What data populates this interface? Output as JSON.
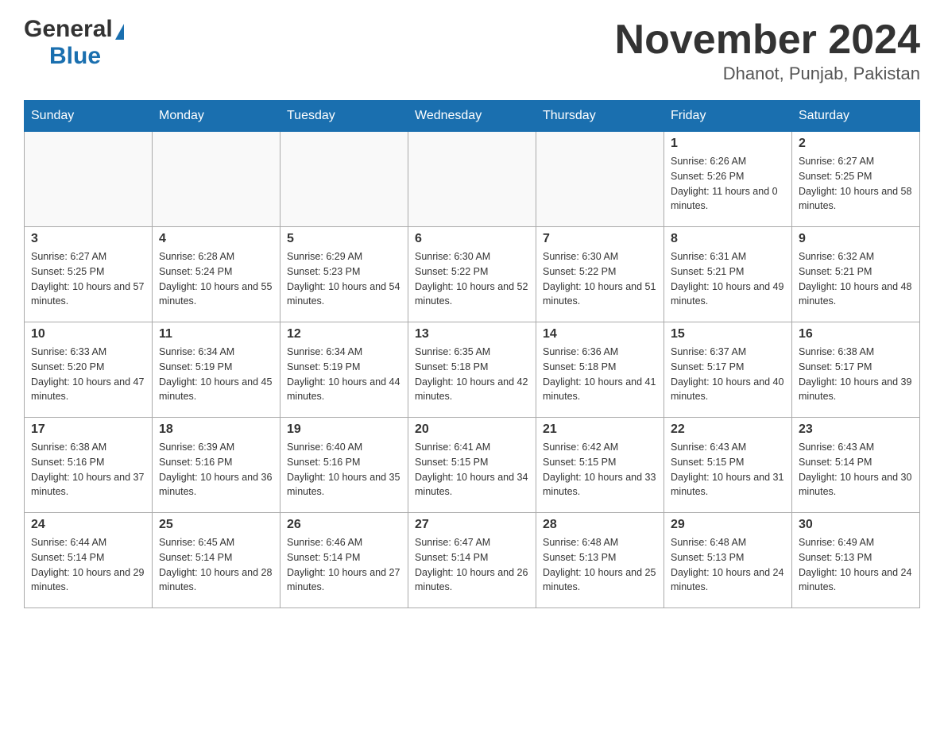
{
  "header": {
    "logo_general": "General",
    "logo_blue": "Blue",
    "month_title": "November 2024",
    "location": "Dhanot, Punjab, Pakistan"
  },
  "weekdays": [
    "Sunday",
    "Monday",
    "Tuesday",
    "Wednesday",
    "Thursday",
    "Friday",
    "Saturday"
  ],
  "weeks": [
    [
      {
        "day": "",
        "info": ""
      },
      {
        "day": "",
        "info": ""
      },
      {
        "day": "",
        "info": ""
      },
      {
        "day": "",
        "info": ""
      },
      {
        "day": "",
        "info": ""
      },
      {
        "day": "1",
        "info": "Sunrise: 6:26 AM\nSunset: 5:26 PM\nDaylight: 11 hours and 0 minutes."
      },
      {
        "day": "2",
        "info": "Sunrise: 6:27 AM\nSunset: 5:25 PM\nDaylight: 10 hours and 58 minutes."
      }
    ],
    [
      {
        "day": "3",
        "info": "Sunrise: 6:27 AM\nSunset: 5:25 PM\nDaylight: 10 hours and 57 minutes."
      },
      {
        "day": "4",
        "info": "Sunrise: 6:28 AM\nSunset: 5:24 PM\nDaylight: 10 hours and 55 minutes."
      },
      {
        "day": "5",
        "info": "Sunrise: 6:29 AM\nSunset: 5:23 PM\nDaylight: 10 hours and 54 minutes."
      },
      {
        "day": "6",
        "info": "Sunrise: 6:30 AM\nSunset: 5:22 PM\nDaylight: 10 hours and 52 minutes."
      },
      {
        "day": "7",
        "info": "Sunrise: 6:30 AM\nSunset: 5:22 PM\nDaylight: 10 hours and 51 minutes."
      },
      {
        "day": "8",
        "info": "Sunrise: 6:31 AM\nSunset: 5:21 PM\nDaylight: 10 hours and 49 minutes."
      },
      {
        "day": "9",
        "info": "Sunrise: 6:32 AM\nSunset: 5:21 PM\nDaylight: 10 hours and 48 minutes."
      }
    ],
    [
      {
        "day": "10",
        "info": "Sunrise: 6:33 AM\nSunset: 5:20 PM\nDaylight: 10 hours and 47 minutes."
      },
      {
        "day": "11",
        "info": "Sunrise: 6:34 AM\nSunset: 5:19 PM\nDaylight: 10 hours and 45 minutes."
      },
      {
        "day": "12",
        "info": "Sunrise: 6:34 AM\nSunset: 5:19 PM\nDaylight: 10 hours and 44 minutes."
      },
      {
        "day": "13",
        "info": "Sunrise: 6:35 AM\nSunset: 5:18 PM\nDaylight: 10 hours and 42 minutes."
      },
      {
        "day": "14",
        "info": "Sunrise: 6:36 AM\nSunset: 5:18 PM\nDaylight: 10 hours and 41 minutes."
      },
      {
        "day": "15",
        "info": "Sunrise: 6:37 AM\nSunset: 5:17 PM\nDaylight: 10 hours and 40 minutes."
      },
      {
        "day": "16",
        "info": "Sunrise: 6:38 AM\nSunset: 5:17 PM\nDaylight: 10 hours and 39 minutes."
      }
    ],
    [
      {
        "day": "17",
        "info": "Sunrise: 6:38 AM\nSunset: 5:16 PM\nDaylight: 10 hours and 37 minutes."
      },
      {
        "day": "18",
        "info": "Sunrise: 6:39 AM\nSunset: 5:16 PM\nDaylight: 10 hours and 36 minutes."
      },
      {
        "day": "19",
        "info": "Sunrise: 6:40 AM\nSunset: 5:16 PM\nDaylight: 10 hours and 35 minutes."
      },
      {
        "day": "20",
        "info": "Sunrise: 6:41 AM\nSunset: 5:15 PM\nDaylight: 10 hours and 34 minutes."
      },
      {
        "day": "21",
        "info": "Sunrise: 6:42 AM\nSunset: 5:15 PM\nDaylight: 10 hours and 33 minutes."
      },
      {
        "day": "22",
        "info": "Sunrise: 6:43 AM\nSunset: 5:15 PM\nDaylight: 10 hours and 31 minutes."
      },
      {
        "day": "23",
        "info": "Sunrise: 6:43 AM\nSunset: 5:14 PM\nDaylight: 10 hours and 30 minutes."
      }
    ],
    [
      {
        "day": "24",
        "info": "Sunrise: 6:44 AM\nSunset: 5:14 PM\nDaylight: 10 hours and 29 minutes."
      },
      {
        "day": "25",
        "info": "Sunrise: 6:45 AM\nSunset: 5:14 PM\nDaylight: 10 hours and 28 minutes."
      },
      {
        "day": "26",
        "info": "Sunrise: 6:46 AM\nSunset: 5:14 PM\nDaylight: 10 hours and 27 minutes."
      },
      {
        "day": "27",
        "info": "Sunrise: 6:47 AM\nSunset: 5:14 PM\nDaylight: 10 hours and 26 minutes."
      },
      {
        "day": "28",
        "info": "Sunrise: 6:48 AM\nSunset: 5:13 PM\nDaylight: 10 hours and 25 minutes."
      },
      {
        "day": "29",
        "info": "Sunrise: 6:48 AM\nSunset: 5:13 PM\nDaylight: 10 hours and 24 minutes."
      },
      {
        "day": "30",
        "info": "Sunrise: 6:49 AM\nSunset: 5:13 PM\nDaylight: 10 hours and 24 minutes."
      }
    ]
  ]
}
